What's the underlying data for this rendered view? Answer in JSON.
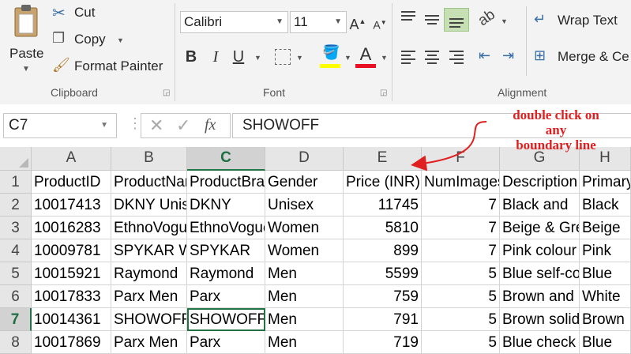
{
  "ribbon": {
    "clipboard": {
      "paste_label": "Paste",
      "cut_label": "Cut",
      "copy_label": "Copy",
      "format_painter_label": "Format Painter",
      "group_label": "Clipboard"
    },
    "font": {
      "font_name": "Calibri",
      "font_size": "11",
      "bold": "B",
      "italic": "I",
      "underline": "U",
      "font_color_glyph": "A",
      "group_label": "Font",
      "highlight_color": "#ffff00",
      "font_color": "#e81123"
    },
    "alignment": {
      "wrap_text_label": "Wrap Text",
      "merge_label": "Merge & Ce",
      "group_label": "Alignment"
    }
  },
  "formula_bar": {
    "name_box": "C7",
    "fx_label": "fx",
    "value": "SHOWOFF"
  },
  "annotation": {
    "line1": "double click on",
    "line2": "any",
    "line3": "boundary line",
    "color": "#e02020"
  },
  "columns": [
    "A",
    "B",
    "C",
    "D",
    "E",
    "F",
    "G",
    "H"
  ],
  "selected_column": "C",
  "selected_row": "7",
  "rows": [
    {
      "num": "1",
      "cells": [
        "ProductID",
        "ProductName",
        "ProductBrand",
        "Gender",
        "Price (INR)",
        "NumImages",
        "Description",
        "PrimaryColor"
      ]
    },
    {
      "num": "2",
      "cells": [
        "10017413",
        "DKNY Unisex",
        "DKNY",
        "Unisex",
        "11745",
        "7",
        "Black and",
        "Black"
      ]
    },
    {
      "num": "3",
      "cells": [
        "10016283",
        "EthnoVogue",
        "EthnoVogue",
        "Women",
        "5810",
        "7",
        "Beige & Grey",
        "Beige"
      ]
    },
    {
      "num": "4",
      "cells": [
        "10009781",
        "SPYKAR Women",
        "SPYKAR",
        "Women",
        "899",
        "7",
        "Pink colour",
        "Pink"
      ]
    },
    {
      "num": "5",
      "cells": [
        "10015921",
        "Raymond",
        "Raymond",
        "Men",
        "5599",
        "5",
        "Blue self-col",
        "Blue"
      ]
    },
    {
      "num": "6",
      "cells": [
        "10017833",
        "Parx Men",
        "Parx",
        "Men",
        "759",
        "5",
        "Brown and",
        "White"
      ]
    },
    {
      "num": "7",
      "cells": [
        "10014361",
        "SHOWOFF",
        "SHOWOFF",
        "Men",
        "791",
        "5",
        "Brown solid",
        "Brown"
      ]
    },
    {
      "num": "8",
      "cells": [
        "10017869",
        "Parx Men",
        "Parx",
        "Men",
        "719",
        "5",
        "Blue check",
        "Blue"
      ]
    }
  ]
}
